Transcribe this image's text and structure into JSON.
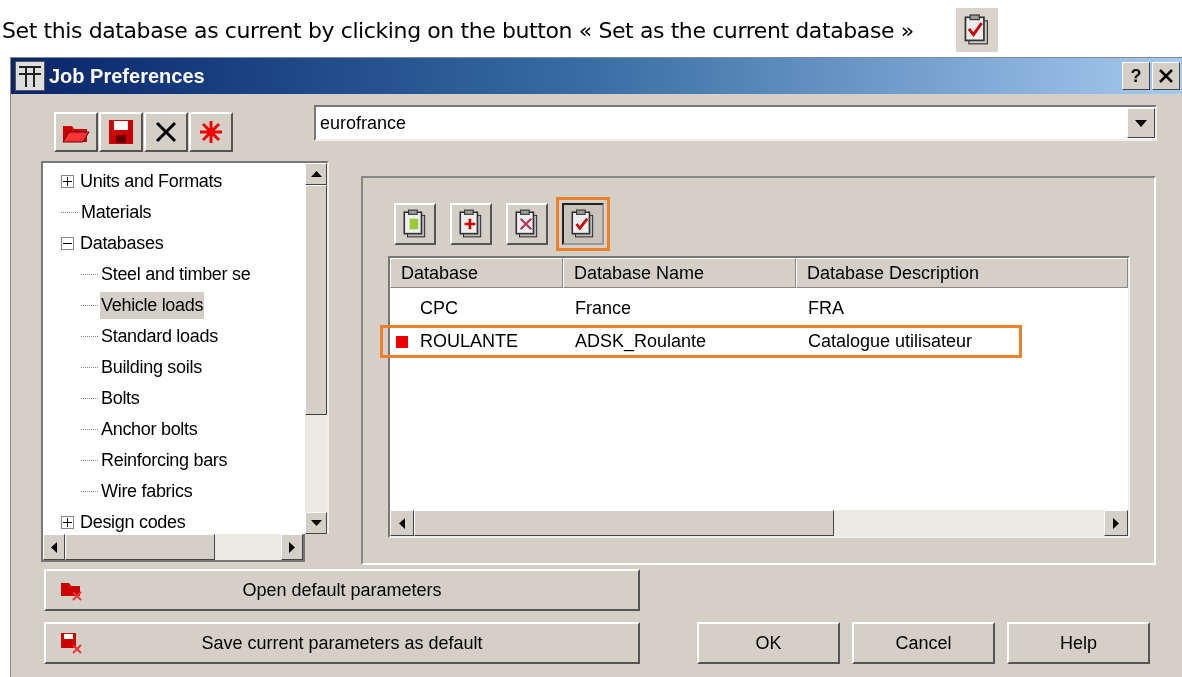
{
  "instruction": {
    "text": "Set this database as current by clicking on the button « Set as the current database »"
  },
  "window": {
    "title": "Job Preferences",
    "help_button": "?"
  },
  "toolbar": [
    {
      "kind": "open"
    },
    {
      "kind": "save"
    },
    {
      "kind": "delete"
    },
    {
      "kind": "new"
    }
  ],
  "job_combo": {
    "value": "eurofrance"
  },
  "tree": [
    {
      "label": "Units and Formats",
      "expanded": false,
      "selected": false
    },
    {
      "label": "Materials",
      "selected": false
    },
    {
      "label": "Databases",
      "expanded": true,
      "selected": false,
      "children": [
        {
          "label": "Steel and timber se",
          "selected": false
        },
        {
          "label": "Vehicle loads",
          "selected": true
        },
        {
          "label": "Standard loads",
          "selected": false
        },
        {
          "label": "Building soils",
          "selected": false
        },
        {
          "label": "Bolts",
          "selected": false
        },
        {
          "label": "Anchor bolts",
          "selected": false
        },
        {
          "label": "Reinforcing bars",
          "selected": false
        },
        {
          "label": "Wire fabrics",
          "selected": false
        }
      ]
    },
    {
      "label": "Design codes",
      "expanded": false,
      "selected": false
    }
  ],
  "db_toolbar": [
    {
      "kind": "load",
      "highlighted": false
    },
    {
      "kind": "add",
      "highlighted": false
    },
    {
      "kind": "remove",
      "highlighted": false
    },
    {
      "kind": "set_current",
      "highlighted": true
    }
  ],
  "table": {
    "columns": [
      "Database",
      "Database Name",
      "Database Description"
    ],
    "rows": [
      {
        "current": false,
        "highlighted": false,
        "cells": [
          "CPC",
          "France",
          "FRA"
        ]
      },
      {
        "current": true,
        "highlighted": true,
        "cells": [
          "ROULANTE",
          "ADSK_Roulante",
          "Catalogue utilisateur"
        ]
      }
    ]
  },
  "buttons": [
    {
      "kind": "open",
      "label": "Open default parameters"
    },
    {
      "kind": "save",
      "label": "Save current parameters as default"
    }
  ],
  "dialog_buttons": [
    "OK",
    "Cancel",
    "Help"
  ]
}
